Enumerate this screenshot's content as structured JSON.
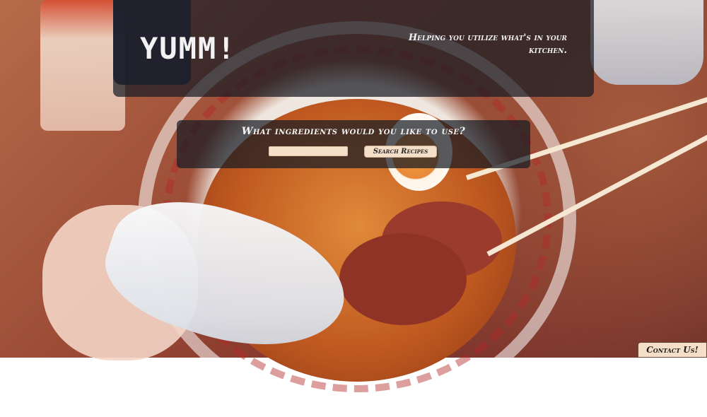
{
  "header": {
    "logo": "YUMM!",
    "tagline": "Helping you utilize what's in your kitchen."
  },
  "search": {
    "question": "What ingredients would you like to use?",
    "input_value": "",
    "input_placeholder": "",
    "button_label": "Search Recipes"
  },
  "footer": {
    "contact_label": "Contact Us!"
  },
  "colors": {
    "panel_bg": "#181c24",
    "button_bg": "#f6dfc9",
    "text_light": "#f2f2f2"
  },
  "background": {
    "description_icon": "ramen-bowl-background"
  }
}
